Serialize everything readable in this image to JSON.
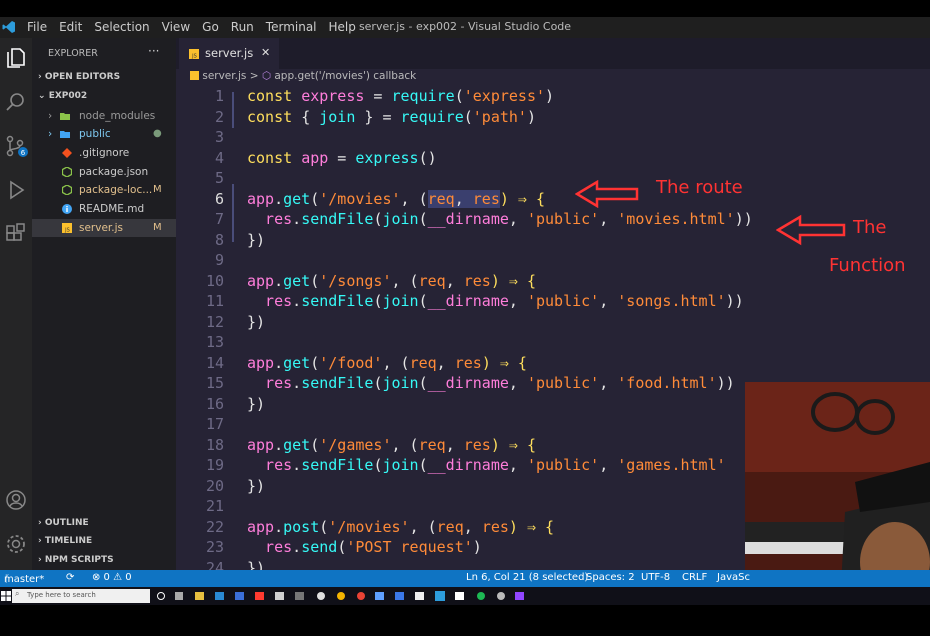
{
  "window": {
    "title": "server.js - exp002 - Visual Studio Code"
  },
  "menu": [
    "File",
    "Edit",
    "Selection",
    "View",
    "Go",
    "Run",
    "Terminal",
    "Help"
  ],
  "sidebar": {
    "title": "EXPLORER",
    "more": "···",
    "open_editors": "OPEN EDITORS",
    "project": "EXP002",
    "items": [
      {
        "label": "node_modules",
        "mark": ""
      },
      {
        "label": "public",
        "mark": "●"
      },
      {
        "label": ".gitignore",
        "mark": ""
      },
      {
        "label": "package.json",
        "mark": ""
      },
      {
        "label": "package-loc...",
        "mark": "M"
      },
      {
        "label": "README.md",
        "mark": ""
      },
      {
        "label": "server.js",
        "mark": "M"
      }
    ],
    "outline": "OUTLINE",
    "timeline": "TIMELINE",
    "npm": "NPM SCRIPTS"
  },
  "tab": {
    "label": "server.js",
    "close": "✕"
  },
  "breadcrumb": {
    "file": "server.js",
    "sep": ">",
    "symbol": "app.get('/movies') callback"
  },
  "line_numbers": [
    "1",
    "2",
    "3",
    "4",
    "5",
    "6",
    "7",
    "8",
    "9",
    "10",
    "11",
    "12",
    "13",
    "14",
    "15",
    "16",
    "17",
    "18",
    "19",
    "20",
    "21",
    "22",
    "23",
    "24"
  ],
  "code": {
    "l1": {
      "a": "const ",
      "b": "express",
      "c": " = ",
      "d": "require",
      "e": "(",
      "f": "'express'",
      "g": ")"
    },
    "l2": {
      "a": "const ",
      "b": "{ ",
      "c": "join",
      "d": " } = ",
      "e": "require",
      "f": "(",
      "g": "'path'",
      "h": ")"
    },
    "l4": {
      "a": "const ",
      "b": "app",
      "c": " = ",
      "d": "express",
      "e": "()"
    },
    "l6": {
      "a": "app",
      "b": ".",
      "c": "get",
      "d": "(",
      "e": "'/movies'",
      "f": ", (",
      "g": "req",
      "h": ", ",
      "i": "res",
      "j": ") ⇒ {"
    },
    "l7": {
      "a": "  res",
      "b": ".",
      "c": "sendFile",
      "d": "(",
      "e": "join",
      "f": "(",
      "g": "__dirname",
      "h": ", ",
      "i": "'public'",
      "j": ", ",
      "k": "'movies.html'",
      "l": "))"
    },
    "l8": "})",
    "l10": {
      "a": "app",
      "b": ".",
      "c": "get",
      "d": "(",
      "e": "'/songs'",
      "f": ", (",
      "g": "req",
      "h": ", ",
      "i": "res",
      "j": ") ⇒ {"
    },
    "l11": {
      "a": "  res",
      "b": ".",
      "c": "sendFile",
      "d": "(",
      "e": "join",
      "f": "(",
      "g": "__dirname",
      "h": ", ",
      "i": "'public'",
      "j": ", ",
      "k": "'songs.html'",
      "l": "))"
    },
    "l12": "})",
    "l14": {
      "a": "app",
      "b": ".",
      "c": "get",
      "d": "(",
      "e": "'/food'",
      "f": ", (",
      "g": "req",
      "h": ", ",
      "i": "res",
      "j": ") ⇒ {"
    },
    "l15": {
      "a": "  res",
      "b": ".",
      "c": "sendFile",
      "d": "(",
      "e": "join",
      "f": "(",
      "g": "__dirname",
      "h": ", ",
      "i": "'public'",
      "j": ", ",
      "k": "'food.html'",
      "l": "))"
    },
    "l16": "})",
    "l18": {
      "a": "app",
      "b": ".",
      "c": "get",
      "d": "(",
      "e": "'/games'",
      "f": ", (",
      "g": "req",
      "h": ", ",
      "i": "res",
      "j": ") ⇒ {"
    },
    "l19": {
      "a": "  res",
      "b": ".",
      "c": "sendFile",
      "d": "(",
      "e": "join",
      "f": "(",
      "g": "__dirname",
      "h": ", ",
      "i": "'public'",
      "j": ", ",
      "k": "'games.html'",
      "l": ""
    },
    "l20": "})",
    "l22": {
      "a": "app",
      "b": ".",
      "c": "post",
      "d": "(",
      "e": "'/movies'",
      "f": ", (",
      "g": "req",
      "h": ", ",
      "i": "res",
      "j": ") ⇒ {"
    },
    "l23": {
      "a": "  res",
      "b": ".",
      "c": "send",
      "d": "(",
      "e": "'POST request'",
      "f": ")"
    },
    "l24": "})"
  },
  "annotations": {
    "route": "The route",
    "function_1": "The",
    "function_2": "Function"
  },
  "status": {
    "branch": "master*",
    "sync": "⟳",
    "problems": "⊗ 0 ⚠ 0",
    "position": "Ln 6, Col 21 (8 selected)",
    "spaces": "Spaces: 2",
    "encoding": "UTF-8",
    "eol": "CRLF",
    "language": "JavaSc"
  },
  "taskbar": {
    "search_placeholder": "Type here to search"
  },
  "colors": {
    "editor_bg": "#262335",
    "status_bg": "#0f74c3",
    "annotation": "#ff3333"
  }
}
